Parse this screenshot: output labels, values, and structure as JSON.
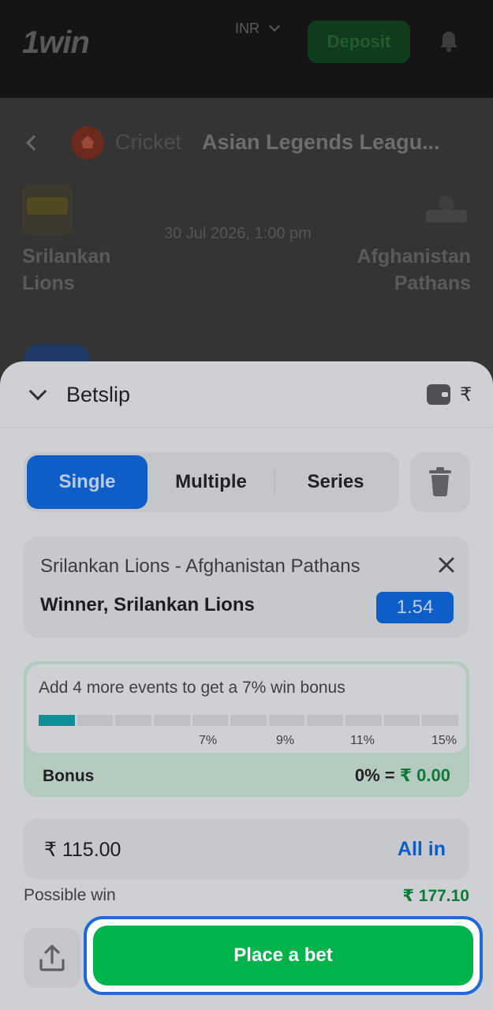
{
  "header": {
    "logo": "1win",
    "currency": "INR",
    "deposit_label": "Deposit"
  },
  "event": {
    "sport": "Cricket",
    "league": "Asian Legends Leagu...",
    "datetime": "30 Jul 2026, 1:00 pm",
    "team1": "Srilankan Lions",
    "team2": "Afghanistan Pathans"
  },
  "betslip": {
    "title": "Betslip",
    "currency_symbol": "₹",
    "tabs": [
      "Single",
      "Multiple",
      "Series"
    ],
    "active_tab": "Single",
    "bet": {
      "match": "Srilankan Lions - Afghanistan Pathans",
      "selection": "Winner, Srilankan Lions",
      "odds": "1.54"
    },
    "bonus": {
      "message": "Add 4 more events to get a 7% win bonus",
      "progress_filled_segments": 1,
      "progress_total_segments": 11,
      "ticks": [
        "7%",
        "9%",
        "11%",
        "15%"
      ],
      "label": "Bonus",
      "percent": "0% =",
      "amount": "₹ 0.00"
    },
    "stake": {
      "value": "₹ 115.00",
      "all_in_label": "All in"
    },
    "possible_win": {
      "label": "Possible win",
      "value": "₹ 177.10"
    },
    "place_bet_label": "Place a bet"
  },
  "colors": {
    "accent_blue": "#0d5fc7",
    "place_bet_green": "#00b34a",
    "win_green": "#0e7a38",
    "progress_teal": "#0f8f97"
  }
}
